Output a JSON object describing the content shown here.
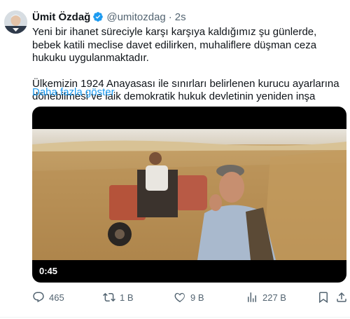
{
  "author": {
    "name": "Ümit Özdağ",
    "handle": "@umitozdag",
    "separator": "·",
    "time": "2s",
    "verified_color": "#1d9bf0"
  },
  "tweet": {
    "paragraph1": "Yeni bir ihanet süreciyle karşı karşıya kaldığımız şu günlerde, bebek katili meclise davet edilirken, muhaliflere düşman ceza hukuku uygulanmaktadır.",
    "paragraph2": "Ülkemizin 1924 Anayasası ile sınırları belirlenen kurucu ayarlarına dönebilmesi ve laik demokratik hukuk devletinin yeniden inşa",
    "show_more": "Daha fazla göster"
  },
  "media": {
    "duration": "0:45"
  },
  "actions": {
    "replies": "465",
    "retweets": "1 B",
    "likes": "9 B",
    "views": "227 B"
  },
  "icons": [
    "verified-badge-icon",
    "reply-icon",
    "retweet-icon",
    "like-icon",
    "views-icon",
    "bookmark-icon",
    "share-icon"
  ],
  "colors": {
    "link": "#1d9bf0",
    "secondary_text": "#536471",
    "primary_text": "#0f1419"
  }
}
